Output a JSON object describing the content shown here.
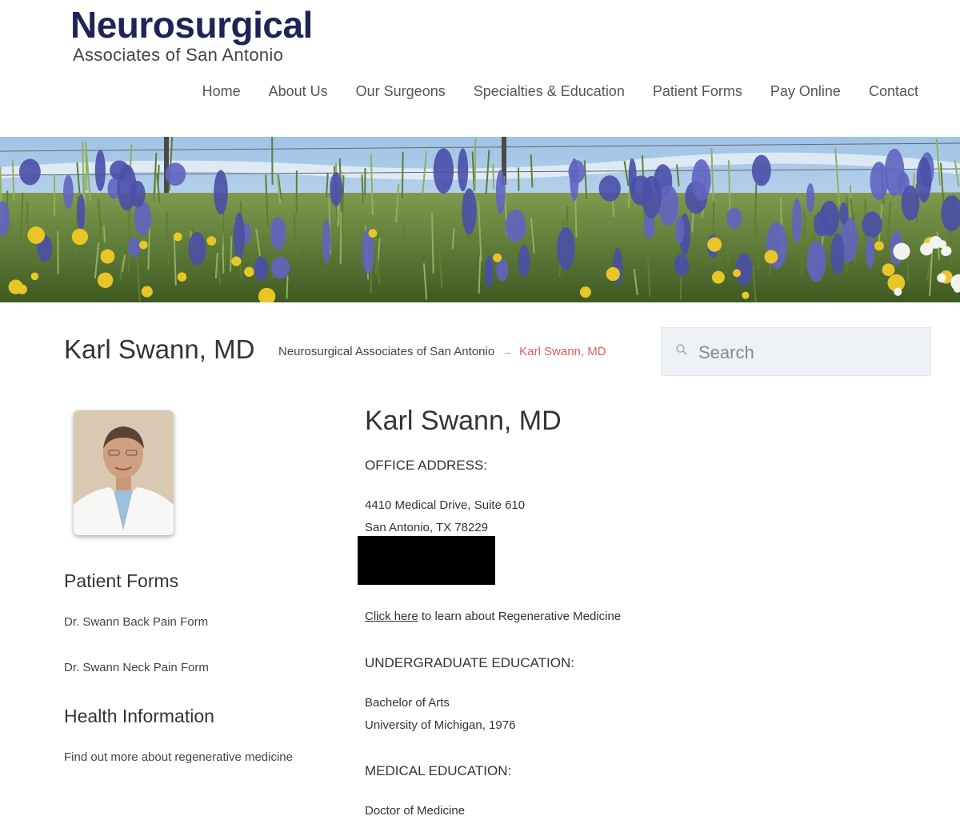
{
  "logo": {
    "main": "Neurosurgical",
    "sub": "Associates of San Antonio"
  },
  "nav": {
    "home": "Home",
    "about": "About Us",
    "surgeons": "Our Surgeons",
    "specialties": "Specialties & Education",
    "patient_forms": "Patient Forms",
    "pay_online": "Pay Online",
    "contact": "Contact"
  },
  "banner": {
    "subject": "bluebonnet wildflower field"
  },
  "page": {
    "title": "Karl Swann, MD",
    "breadcrumb": {
      "home": "Neurosurgical Associates of San Antonio",
      "separator": "→",
      "current": "Karl Swann, MD"
    }
  },
  "search": {
    "placeholder": "Search",
    "icon": "search-icon"
  },
  "sidebar": {
    "patient_forms_heading": "Patient Forms",
    "back_pain_form": "Dr. Swann Back Pain Form",
    "neck_pain_form": "Dr. Swann Neck Pain Form",
    "health_heading": "Health Information",
    "health_link": "Find out more about regenerative medicine"
  },
  "doctor": {
    "name": "Karl Swann, MD",
    "office_label": "OFFICE ADDRESS:",
    "address_line1": "4410 Medical Drive, Suite 610",
    "address_line2": "San Antonio, TX 78229",
    "click_here": "Click here",
    "regen_text": " to learn about Regenerative Medicine",
    "undergrad_label": "UNDERGRADUATE EDUCATION:",
    "undergrad_degree": "Bachelor of Arts",
    "undergrad_school": "University of Michigan, 1976",
    "medical_label": "MEDICAL EDUCATION:",
    "medical_degree": "Doctor of Medicine"
  },
  "colors": {
    "brand_navy": "#1e2456",
    "breadcrumb_current": "#e25c5c",
    "search_bg": "#eef1f5"
  }
}
